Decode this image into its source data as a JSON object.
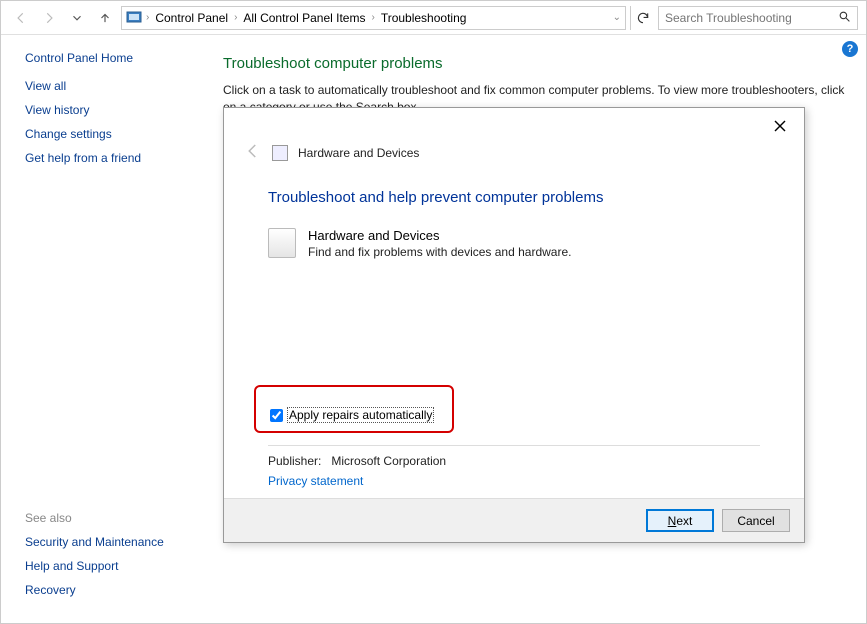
{
  "toolbar": {
    "breadcrumbs": [
      "Control Panel",
      "All Control Panel Items",
      "Troubleshooting"
    ],
    "search_placeholder": "Search Troubleshooting"
  },
  "sidebar": {
    "home": "Control Panel Home",
    "links": [
      "View all",
      "View history",
      "Change settings",
      "Get help from a friend"
    ],
    "see_also_heading": "See also",
    "see_also": [
      "Security and Maintenance",
      "Help and Support",
      "Recovery"
    ]
  },
  "content": {
    "title": "Troubleshoot computer problems",
    "desc": "Click on a task to automatically troubleshoot and fix common computer problems. To view more troubleshooters, click on a category or use the Search box."
  },
  "dialog": {
    "header": "Hardware and Devices",
    "heading": "Troubleshoot and help prevent computer problems",
    "item_title": "Hardware and Devices",
    "item_desc": "Find and fix problems with devices and hardware.",
    "checkbox_label": "Apply repairs automatically",
    "publisher_label": "Publisher:",
    "publisher_value": "Microsoft Corporation",
    "privacy": "Privacy statement",
    "next": "Next",
    "cancel": "Cancel"
  }
}
